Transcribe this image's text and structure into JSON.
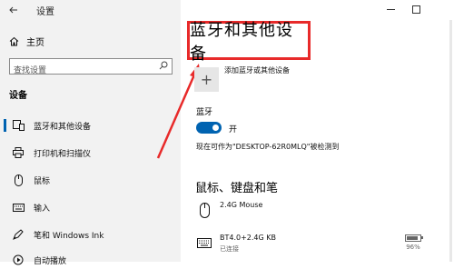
{
  "window": {
    "title": "设置"
  },
  "sidebar": {
    "home_label": "主页",
    "search_placeholder": "查找设置",
    "section_title": "设备",
    "items": [
      {
        "label": "蓝牙和其他设备",
        "icon": "bluetooth-devices-icon",
        "active": true
      },
      {
        "label": "打印机和扫描仪",
        "icon": "printer-icon"
      },
      {
        "label": "鼠标",
        "icon": "mouse-icon"
      },
      {
        "label": "输入",
        "icon": "keyboard-icon"
      },
      {
        "label": "笔和 Windows Ink",
        "icon": "pen-icon"
      },
      {
        "label": "自动播放",
        "icon": "autoplay-icon"
      }
    ]
  },
  "main": {
    "page_title": "蓝牙和其他设备",
    "add_device_label": "添加蓝牙或其他设备",
    "bluetooth_label": "蓝牙",
    "toggle_state": "开",
    "discoverable_text": "现在可作为\"DESKTOP-62R0MLQ\"被检测到",
    "mkp_header": "鼠标、键盘和笔",
    "devices": [
      {
        "name": "2.4G Mouse",
        "status": "",
        "icon": "mouse-icon"
      },
      {
        "name": "BT4.0+2.4G KB",
        "status": "已连接",
        "battery": "96%",
        "battery_level": 0.96,
        "icon": "keyboard-icon"
      }
    ]
  },
  "colors": {
    "accent": "#0063b1",
    "highlight": "#e82a2a"
  }
}
